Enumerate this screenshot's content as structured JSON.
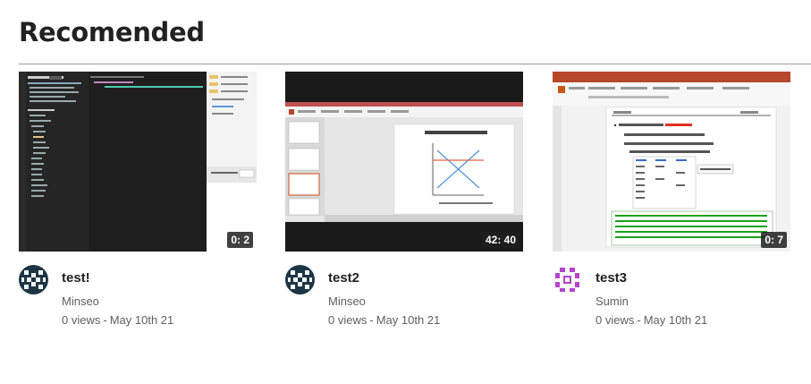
{
  "heading": "Recomended",
  "videos": [
    {
      "title": "test!",
      "channel": "Minseo",
      "views": "0 views",
      "separator": "-",
      "date": "May 10th 21",
      "duration": "0: 2"
    },
    {
      "title": "test2",
      "channel": "Minseo",
      "views": "0 views",
      "separator": "-",
      "date": "May 10th 21",
      "duration": "42: 40"
    },
    {
      "title": "test3",
      "channel": "Sumin",
      "views": "0 views",
      "separator": "-",
      "date": "May 10th 21",
      "duration": "0: 7"
    }
  ],
  "colors": {
    "avatar_dark": "#1d3644",
    "avatar_purple": "#b344cc",
    "ppt_red": "#b7472a",
    "editor_bg": "#1e1e1e"
  }
}
